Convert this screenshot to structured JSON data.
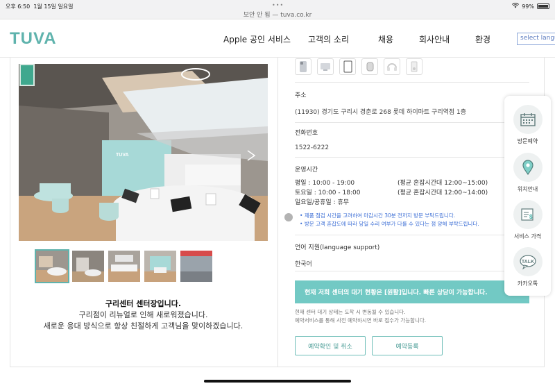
{
  "statusbar": {
    "time": "오후 6:50",
    "date": "1월 15일 일요일",
    "url": "보안 안 됨 — tuva.co.kr",
    "battery": "99%"
  },
  "header": {
    "logo": "TUVA",
    "nav": [
      "Apple 공인 서비스",
      "고객의 소리",
      "채용",
      "회사안내",
      "환경"
    ],
    "lang_placeholder": "select langua"
  },
  "store": {
    "title": "구리센터 센터장입니다.",
    "line1": "구리점이 리뉴얼로 인해 새로워졌습니다.",
    "line2": "새로운 응대 방식으로 항상 친절하게 고객님을 맞이하겠습니다."
  },
  "info": {
    "address_label": "주소",
    "address": "(11930) 경기도 구리시 경춘로 268 롯데 하이마트 구리역점 1층",
    "phone_label": "전화번호",
    "phone": "1522-6222",
    "hours_label": "운영시간",
    "hours": [
      {
        "day": "평일 : 10:00 - 19:00",
        "busy": "(평균 혼잡시간대 12:00~15:00)"
      },
      {
        "day": "토요일 : 10:00 - 18:00",
        "busy": "(평균 혼잡시간대 12:00~14:00)"
      },
      {
        "day": "일요일/공휴일 : 휴무",
        "busy": ""
      }
    ],
    "notes": [
      "제품 점검 시간을 고려하여 마감시간 30분 전까지 방문 부탁드립니다.",
      "방문 고객 혼잡도에 따라 당일 수리 여부가 다를 수 있다는 점 양해 부탁드립니다."
    ],
    "language_label": "언어 지원(language support)",
    "language": "한국어",
    "banner": "현재 저희 센터의 대기 현황은 [원활]입니다. 빠른 상담이 가능합니다.",
    "small_notes": [
      "현재 센터 대기 상태는 도착 시 변동될 수 있습니다.",
      "예약서비스를 통해 사전 예약하시면 바로 접수가 가능합니다."
    ],
    "btn_check": "예약확인 및 취소",
    "btn_register": "예약등록"
  },
  "quick_menu": [
    {
      "label": "방문예약",
      "icon": "calendar-icon"
    },
    {
      "label": "위치안내",
      "icon": "location-pin-icon"
    },
    {
      "label": "서비스 가격",
      "icon": "price-receipt-icon"
    },
    {
      "label": "카카오톡",
      "icon": "kakaotalk-icon",
      "icon_text": "TALK"
    }
  ],
  "colors": {
    "brand": "#5fb3ad",
    "banner": "#72c9c4",
    "note_blue": "#3d6fd6"
  }
}
